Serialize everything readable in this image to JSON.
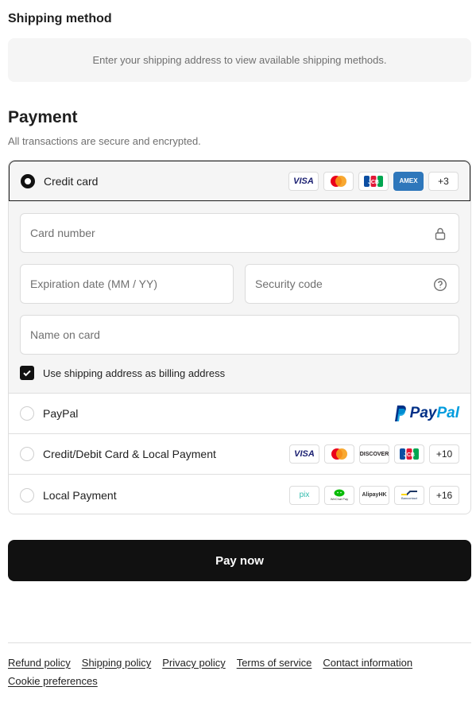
{
  "shipping": {
    "title": "Shipping method",
    "message": "Enter your shipping address to view available shipping methods."
  },
  "payment": {
    "title": "Payment",
    "subtitle": "All transactions are secure and encrypted.",
    "credit_card": {
      "label": "Credit card",
      "selected": true,
      "logos": [
        "VISA",
        "Mastercard",
        "JCB",
        "AMEX"
      ],
      "more": "+3"
    },
    "fields": {
      "card_number": "Card number",
      "expiration": "Expiration date (MM / YY)",
      "security_code": "Security code",
      "name_on_card": "Name on card"
    },
    "billing": {
      "label": "Use shipping address as billing address",
      "checked": true
    },
    "paypal": {
      "label": "PayPal",
      "logo_text_1": "Pay",
      "logo_text_2": "Pal"
    },
    "credit_debit_local": {
      "label": "Credit/Debit Card & Local Payment",
      "logos": [
        "VISA",
        "Mastercard",
        "DISCOVER",
        "JCB"
      ],
      "more": "+10"
    },
    "local_payment": {
      "label": "Local Payment",
      "logos": [
        "pix",
        "WeChat Pay",
        "AlipayHK",
        "Bancontact"
      ],
      "more": "+16"
    },
    "pay_now": "Pay now"
  },
  "footer": {
    "links": [
      "Refund policy",
      "Shipping policy",
      "Privacy policy",
      "Terms of service",
      "Contact information",
      "Cookie preferences"
    ]
  },
  "colors": {
    "primary": "#111111",
    "panel_bg": "#f5f5f5",
    "border": "#dedede",
    "muted_text": "#707070",
    "paypal_dark": "#003087",
    "paypal_light": "#009cde",
    "visa": "#1a1f71",
    "amex": "#2e77bb"
  }
}
